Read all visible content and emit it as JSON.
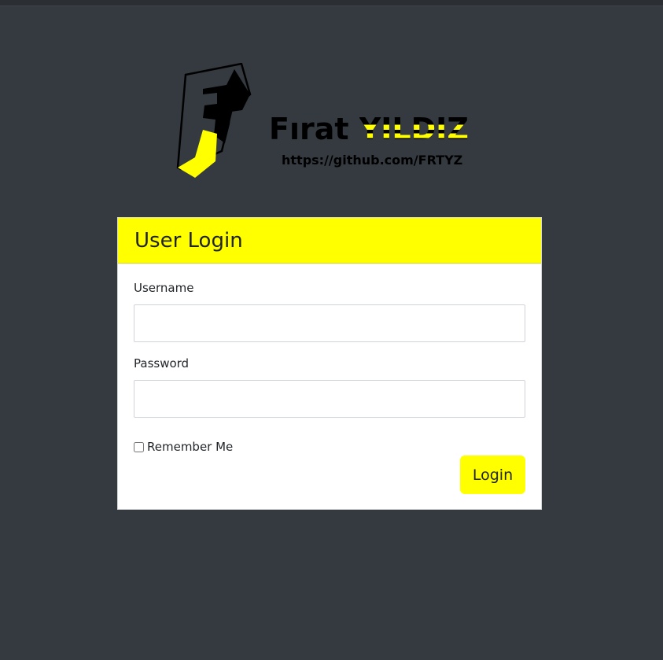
{
  "logo": {
    "name_first": "Fırat",
    "name_last": "YILDIZ",
    "url": "https://github.com/FRTYZ"
  },
  "form": {
    "title": "User Login",
    "username_label": "Username",
    "username_value": "",
    "password_label": "Password",
    "password_value": "",
    "remember_label": "Remember Me",
    "remember_checked": false,
    "submit_label": "Login"
  },
  "colors": {
    "background": "#343a40",
    "accent": "#ffff00",
    "card": "#ffffff"
  }
}
